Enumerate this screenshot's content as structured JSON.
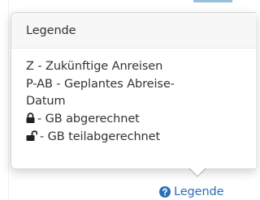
{
  "popover": {
    "title": "Legende",
    "lines": {
      "z": "Z - Zukünftige Anreisen",
      "pab_1": "P-AB - Geplantes Abreise-",
      "pab_2": "Datum",
      "gb_abgerechnet": "- GB abgerechnet",
      "gb_teilabgerechnet": "- GB teilabgerechnet"
    },
    "icons": {
      "locked": "lock-icon",
      "unlocked": "unlock-icon"
    }
  },
  "trigger": {
    "label": "Legende",
    "icon": "question-circle-icon",
    "color": "#2a6ebb"
  }
}
